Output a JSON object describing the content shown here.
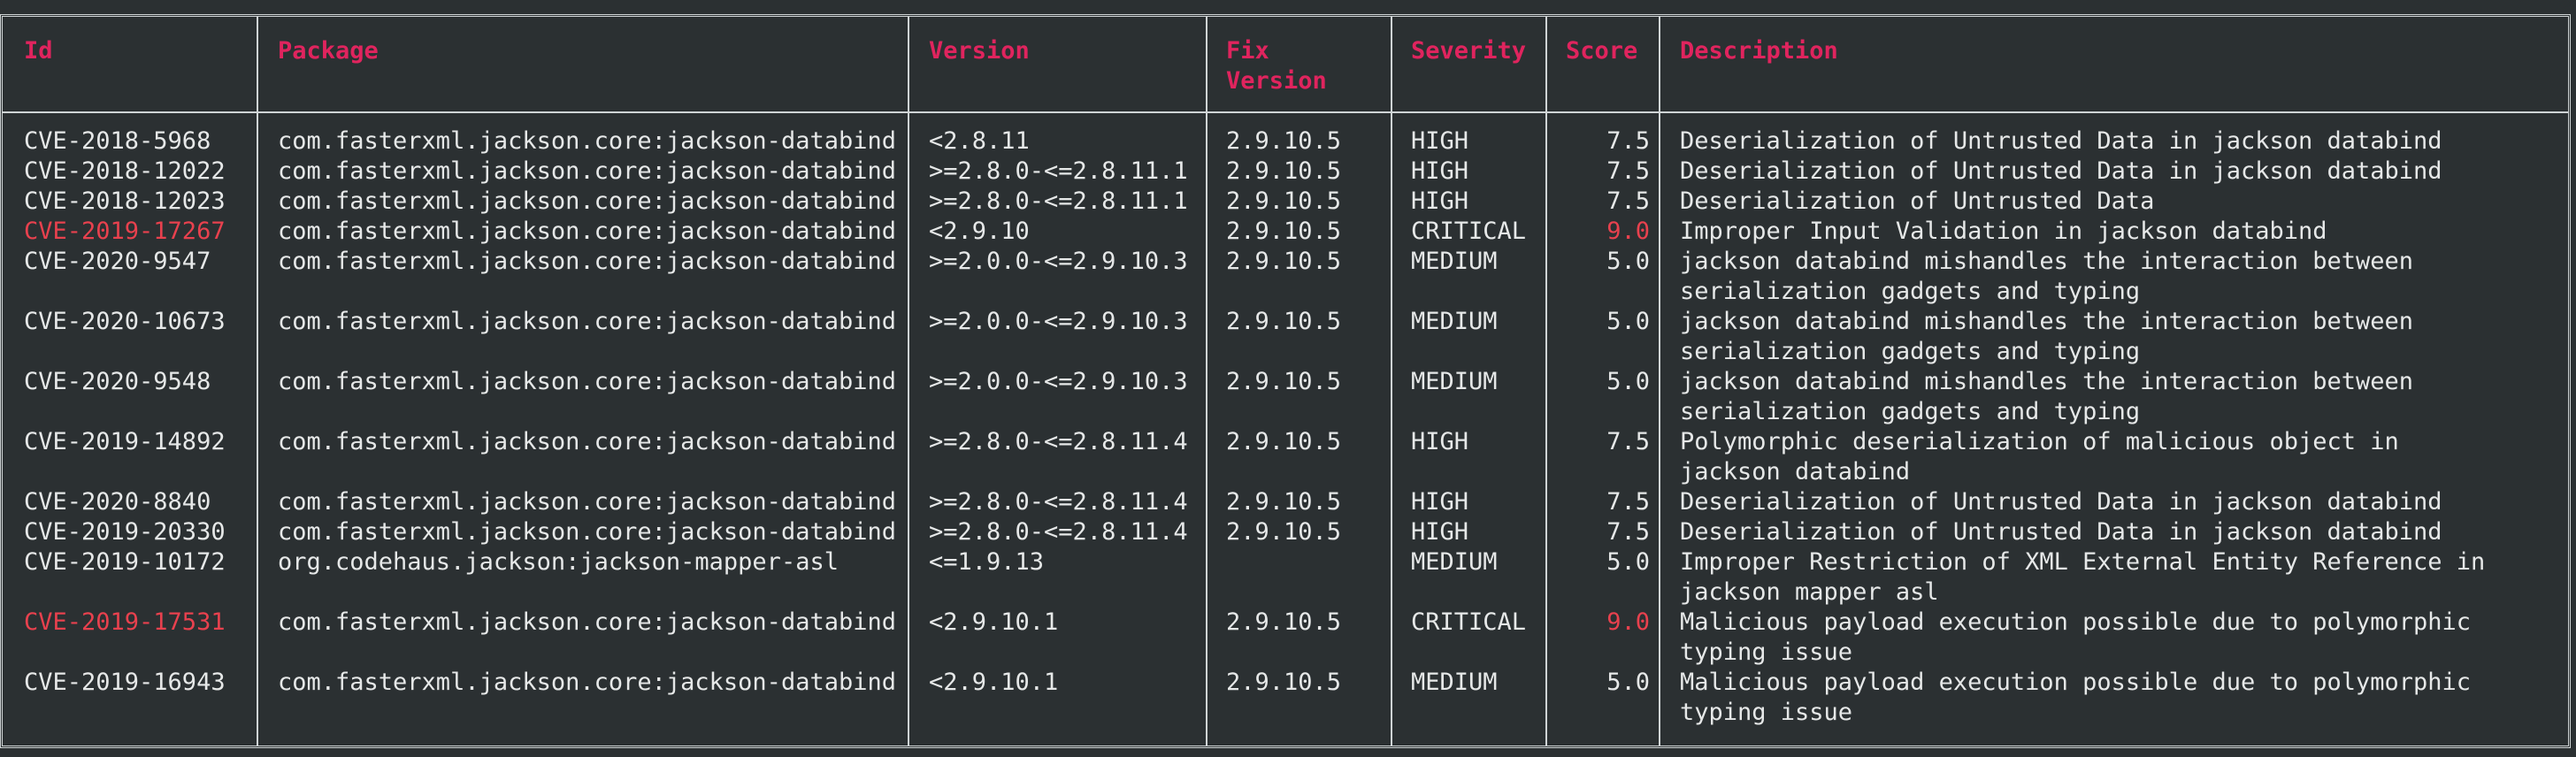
{
  "colors": {
    "background": "#2b3032",
    "text": "#e6e8e8",
    "header": "#e0245e",
    "critical": "#e8414e",
    "border": "#cfd4d5"
  },
  "headers": {
    "id": "Id",
    "package": "Package",
    "version": "Version",
    "fix_version": "Fix\nVersion",
    "severity": "Severity",
    "score": "Score",
    "description": "Description"
  },
  "rows": [
    {
      "id": "CVE-2018-5968",
      "package": "com.fasterxml.jackson.core:jackson-databind",
      "version": "<2.8.11",
      "fix": "2.9.10.5",
      "severity": "HIGH",
      "score": "7.5",
      "description": "Deserialization of Untrusted Data in jackson databind",
      "critical": false
    },
    {
      "id": "CVE-2018-12022",
      "package": "com.fasterxml.jackson.core:jackson-databind",
      "version": ">=2.8.0-<=2.8.11.1",
      "fix": "2.9.10.5",
      "severity": "HIGH",
      "score": "7.5",
      "description": "Deserialization of Untrusted Data in jackson databind",
      "critical": false
    },
    {
      "id": "CVE-2018-12023",
      "package": "com.fasterxml.jackson.core:jackson-databind",
      "version": ">=2.8.0-<=2.8.11.1",
      "fix": "2.9.10.5",
      "severity": "HIGH",
      "score": "7.5",
      "description": "Deserialization of Untrusted Data",
      "critical": false
    },
    {
      "id": "CVE-2019-17267",
      "package": "com.fasterxml.jackson.core:jackson-databind",
      "version": "<2.9.10",
      "fix": "2.9.10.5",
      "severity": "CRITICAL",
      "score": "9.0",
      "description": "Improper Input Validation in jackson databind",
      "critical": true
    },
    {
      "id": "CVE-2020-9547",
      "package": "com.fasterxml.jackson.core:jackson-databind",
      "version": ">=2.0.0-<=2.9.10.3",
      "fix": "2.9.10.5",
      "severity": "MEDIUM",
      "score": "5.0",
      "description": "jackson databind mishandles the interaction between serialization gadgets and typing",
      "critical": false
    },
    {
      "id": "CVE-2020-10673",
      "package": "com.fasterxml.jackson.core:jackson-databind",
      "version": ">=2.0.0-<=2.9.10.3",
      "fix": "2.9.10.5",
      "severity": "MEDIUM",
      "score": "5.0",
      "description": "jackson databind mishandles the interaction between serialization gadgets and typing",
      "critical": false
    },
    {
      "id": "CVE-2020-9548",
      "package": "com.fasterxml.jackson.core:jackson-databind",
      "version": ">=2.0.0-<=2.9.10.3",
      "fix": "2.9.10.5",
      "severity": "MEDIUM",
      "score": "5.0",
      "description": "jackson databind mishandles the interaction between serialization gadgets and typing",
      "critical": false
    },
    {
      "id": "CVE-2019-14892",
      "package": "com.fasterxml.jackson.core:jackson-databind",
      "version": ">=2.8.0-<=2.8.11.4",
      "fix": "2.9.10.5",
      "severity": "HIGH",
      "score": "7.5",
      "description": "Polymorphic deserialization of malicious object in jackson databind",
      "critical": false
    },
    {
      "id": "CVE-2020-8840",
      "package": "com.fasterxml.jackson.core:jackson-databind",
      "version": ">=2.8.0-<=2.8.11.4",
      "fix": "2.9.10.5",
      "severity": "HIGH",
      "score": "7.5",
      "description": "Deserialization of Untrusted Data in jackson databind",
      "critical": false
    },
    {
      "id": "CVE-2019-20330",
      "package": "com.fasterxml.jackson.core:jackson-databind",
      "version": ">=2.8.0-<=2.8.11.4",
      "fix": "2.9.10.5",
      "severity": "HIGH",
      "score": "7.5",
      "description": "Deserialization of Untrusted Data in jackson databind",
      "critical": false
    },
    {
      "id": "CVE-2019-10172",
      "package": "org.codehaus.jackson:jackson-mapper-asl",
      "version": "<=1.9.13",
      "fix": "",
      "severity": "MEDIUM",
      "score": "5.0",
      "description": "Improper Restriction of XML External Entity Reference in jackson mapper asl",
      "critical": false
    },
    {
      "id": "CVE-2019-17531",
      "package": "com.fasterxml.jackson.core:jackson-databind",
      "version": "<2.9.10.1",
      "fix": "2.9.10.5",
      "severity": "CRITICAL",
      "score": "9.0",
      "description": "Malicious payload execution possible due to polymorphic typing issue",
      "critical": true
    },
    {
      "id": "CVE-2019-16943",
      "package": "com.fasterxml.jackson.core:jackson-databind",
      "version": "<2.9.10.1",
      "fix": "2.9.10.5",
      "severity": "MEDIUM",
      "score": "5.0",
      "description": "Malicious payload execution possible due to polymorphic typing issue",
      "critical": false
    }
  ]
}
